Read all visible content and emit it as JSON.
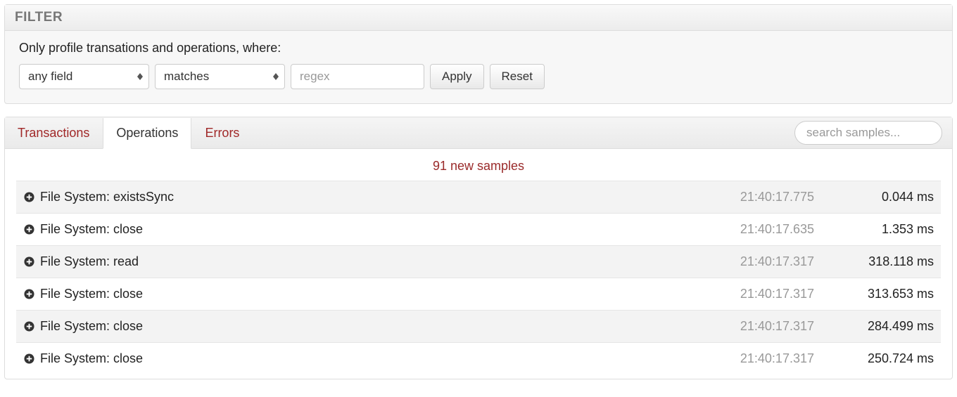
{
  "filter": {
    "title": "FILTER",
    "description": "Only profile transations and operations, where:",
    "field_select": "any field",
    "match_select": "matches",
    "regex_placeholder": "regex",
    "apply_label": "Apply",
    "reset_label": "Reset"
  },
  "tabs": {
    "transactions": "Transactions",
    "operations": "Operations",
    "errors": "Errors",
    "active": "operations"
  },
  "search": {
    "placeholder": "search samples..."
  },
  "samples_banner": "91 new samples",
  "operations": [
    {
      "name": "File System: existsSync",
      "time": "21:40:17.775",
      "duration": "0.044 ms"
    },
    {
      "name": "File System: close",
      "time": "21:40:17.635",
      "duration": "1.353 ms"
    },
    {
      "name": "File System: read",
      "time": "21:40:17.317",
      "duration": "318.118 ms"
    },
    {
      "name": "File System: close",
      "time": "21:40:17.317",
      "duration": "313.653 ms"
    },
    {
      "name": "File System: close",
      "time": "21:40:17.317",
      "duration": "284.499 ms"
    },
    {
      "name": "File System: close",
      "time": "21:40:17.317",
      "duration": "250.724 ms"
    }
  ]
}
